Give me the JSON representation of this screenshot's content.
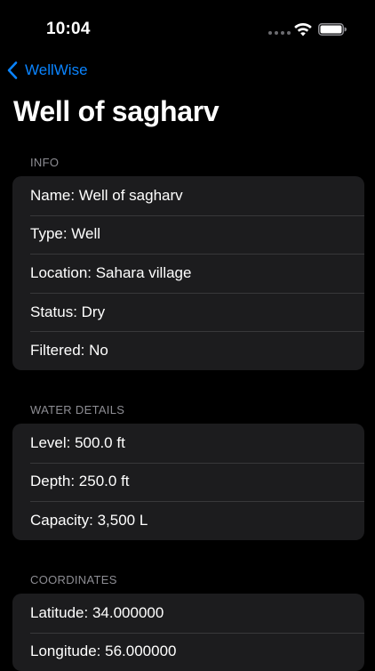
{
  "status_bar": {
    "time": "10:04"
  },
  "nav": {
    "back_label": "WellWise"
  },
  "page": {
    "title": "Well of sagharv"
  },
  "sections": {
    "info": {
      "header": "INFO",
      "rows": [
        "Name: Well of sagharv",
        "Type: Well",
        "Location: Sahara village",
        "Status: Dry",
        "Filtered: No"
      ]
    },
    "water": {
      "header": "WATER DETAILS",
      "rows": [
        "Level: 500.0 ft",
        "Depth: 250.0 ft",
        "Capacity: 3,500 L"
      ]
    },
    "coords": {
      "header": "COORDINATES",
      "rows": [
        "Latitude: 34.000000",
        "Longitude: 56.000000"
      ]
    }
  },
  "colors": {
    "accent": "#0a84ff",
    "background": "#000000",
    "card": "#1c1c1e",
    "secondary_text": "#8d8d93"
  }
}
